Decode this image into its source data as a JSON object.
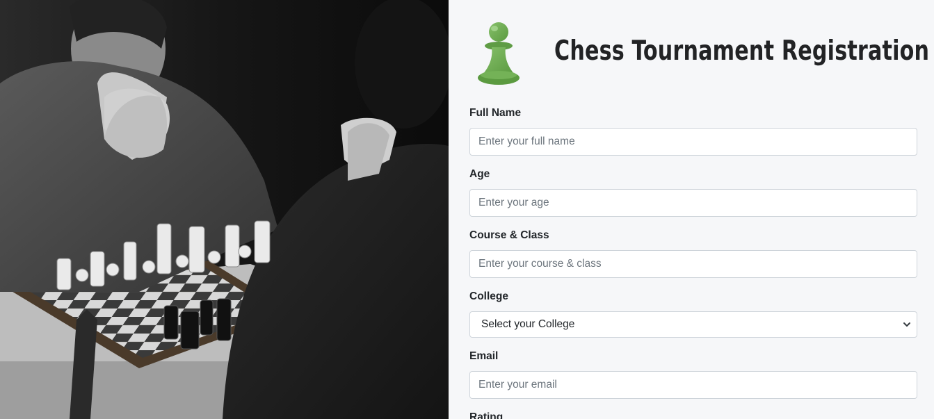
{
  "header": {
    "title": "Chess Tournament Registration",
    "logo_icon": "pawn-icon",
    "logo_color": "#6aa84f"
  },
  "form": {
    "full_name": {
      "label": "Full Name",
      "placeholder": "Enter your full name",
      "value": ""
    },
    "age": {
      "label": "Age",
      "placeholder": "Enter your age",
      "value": ""
    },
    "course_class": {
      "label": "Course & Class",
      "placeholder": "Enter your course & class",
      "value": ""
    },
    "college": {
      "label": "College",
      "selected": "Select your College"
    },
    "email": {
      "label": "Email",
      "placeholder": "Enter your email",
      "value": ""
    },
    "rating": {
      "label": "Rating"
    }
  },
  "colors": {
    "panel_bg": "#f6f7f9",
    "input_border": "#ced4da",
    "text": "#212529",
    "placeholder": "#6c757d"
  }
}
